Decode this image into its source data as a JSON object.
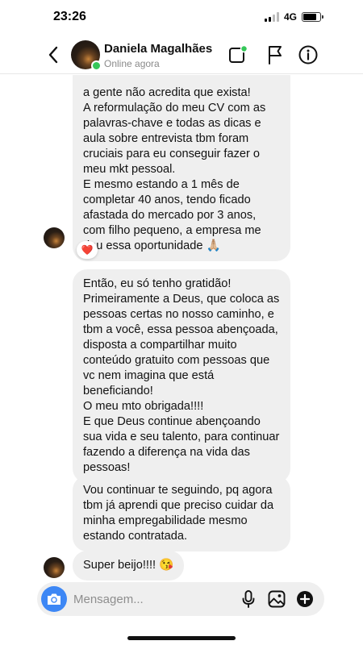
{
  "status_bar": {
    "time": "23:26",
    "network": "4G",
    "signal_bars_active": 2,
    "signal_bars_total": 4,
    "battery_level": 0.85
  },
  "header": {
    "contact_name": "Daniela Magalhães",
    "contact_status": "Online agora",
    "online_color": "#35c759",
    "icons": [
      "back-chevron-icon",
      "video-call-icon",
      "flag-icon",
      "info-icon"
    ]
  },
  "messages": [
    {
      "lines": [
        "a gente não acredita que exista!",
        "A reformulação do meu CV com as palavras-chave e todas as dicas e aula sobre entrevista tbm foram cruciais para eu conseguir fazer o meu mkt pessoal.",
        "E mesmo estando a 1 mês de completar 40 anos, tendo ficado afastada do mercado por 3 anos, com filho pequeno, a empresa me deu essa oportunidade 🙏🏼"
      ],
      "reaction": "❤️"
    },
    {
      "lines": [
        "Então, eu só tenho gratidão!",
        "Primeiramente a Deus, que coloca as pessoas certas no nosso caminho, e tbm a você, essa pessoa abençoada, disposta a compartilhar muito conteúdo gratuito com pessoas que vc nem imagina que está beneficiando!",
        "O meu mto obrigada!!!!",
        "E que Deus continue abençoando sua vida e seu talento, para continuar fazendo a diferença na vida das pessoas!"
      ]
    },
    {
      "lines": [
        "Vou continuar te seguindo, pq agora tbm já aprendi que preciso cuidar da minha empregabilidade mesmo estando contratada."
      ]
    },
    {
      "lines": [
        "Super beijo!!!! 😘"
      ]
    }
  ],
  "composer": {
    "placeholder": "Mensagem...",
    "accent_color": "#3d87f5",
    "icons": [
      "camera-icon",
      "microphone-icon",
      "gallery-icon",
      "plus-icon"
    ]
  }
}
